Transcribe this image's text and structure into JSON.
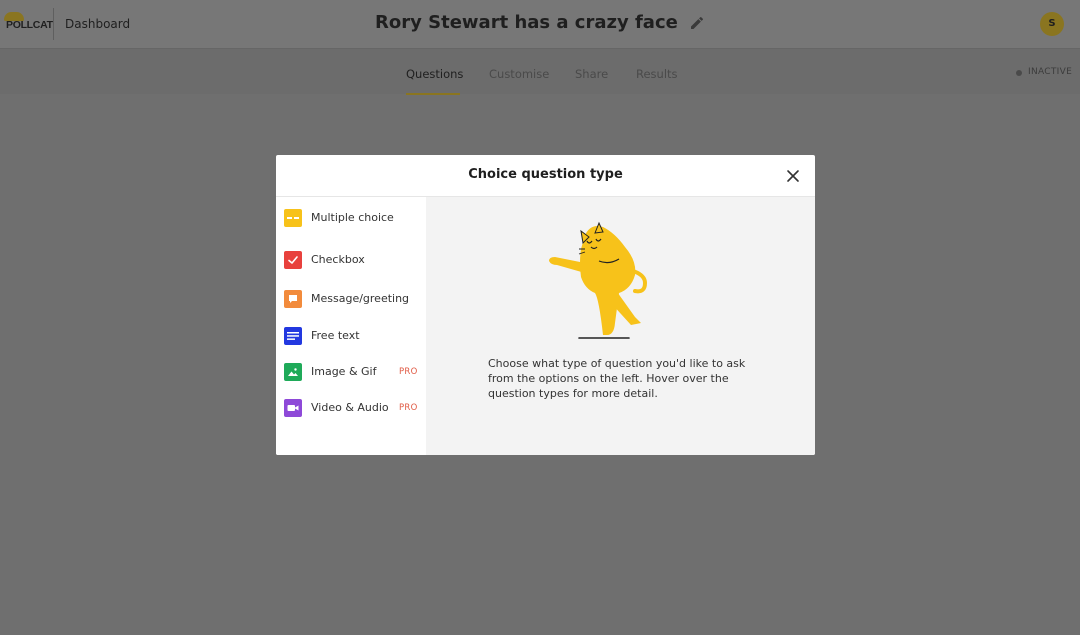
{
  "header": {
    "logo_text": "POLLCAT",
    "dashboard_link": "Dashboard",
    "survey_title": "Rory Stewart has a crazy face",
    "avatar_initial": "S",
    "brand_color": "#8a7520"
  },
  "tabs": [
    {
      "label": "Questions",
      "active": true
    },
    {
      "label": "Customise",
      "active": false
    },
    {
      "label": "Share",
      "active": false
    },
    {
      "label": "Results",
      "active": false
    }
  ],
  "status": {
    "label": "INACTIVE"
  },
  "modal": {
    "title": "Choice question type",
    "options": [
      {
        "label": "Multiple choice",
        "icon": "multiple-choice-icon",
        "color": "#f7c21a",
        "pro": ""
      },
      {
        "label": "Checkbox",
        "icon": "checkbox-icon",
        "color": "#e8413d",
        "pro": ""
      },
      {
        "label": "Message/greeting",
        "icon": "message-icon",
        "color": "#f28b3c",
        "pro": ""
      },
      {
        "label": "Free text",
        "icon": "free-text-icon",
        "color": "#2238e0",
        "pro": ""
      },
      {
        "label": "Image & Gif",
        "icon": "image-icon",
        "color": "#1faa59",
        "pro": "PRO"
      },
      {
        "label": "Video & Audio",
        "icon": "video-icon",
        "color": "#8e49d8",
        "pro": "PRO"
      }
    ],
    "description": "Choose what type of question you'd like to ask from the options on the left. Hover over the question types for more detail."
  }
}
